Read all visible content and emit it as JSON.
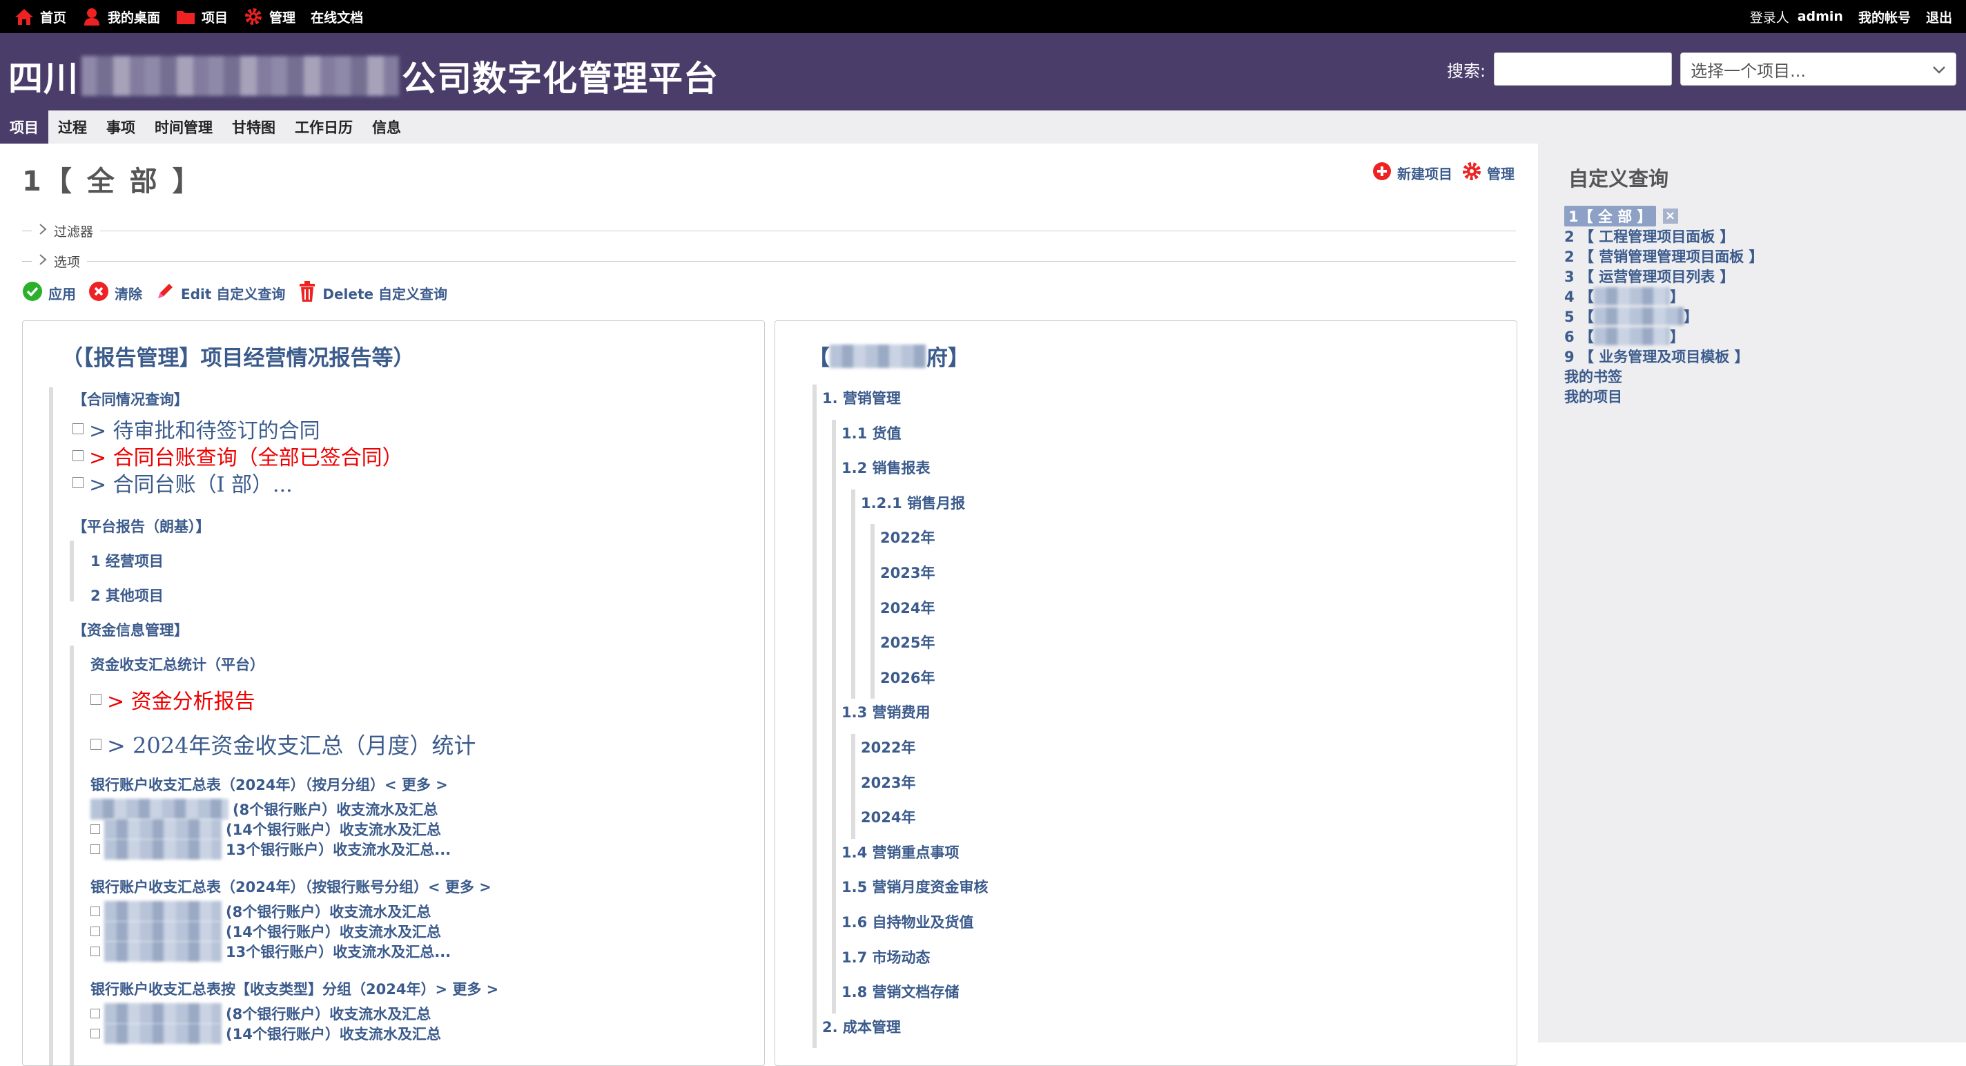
{
  "top_menu": {
    "items": [
      {
        "label": "首页",
        "icon": "home-icon"
      },
      {
        "label": "我的桌面",
        "icon": "user-icon"
      },
      {
        "label": "项目",
        "icon": "folder-icon"
      },
      {
        "label": "管理",
        "icon": "gear-icon"
      },
      {
        "label": "在线文档",
        "icon": ""
      }
    ],
    "login_prefix": "登录人",
    "login_user": "admin",
    "account": "我的帐号",
    "logout": "退出"
  },
  "header": {
    "title_prefix": "四川",
    "title_suffix": "公司数字化管理平台",
    "search_label": "搜索:",
    "search_value": "",
    "project_select": "选择一个项目..."
  },
  "main_menu": {
    "tabs": [
      "项目",
      "过程",
      "事项",
      "时间管理",
      "甘特图",
      "工作日历",
      "信息"
    ]
  },
  "content": {
    "title": "1【 全 部 】",
    "new_project": "新建项目",
    "manage": "管理",
    "filters_label": "过滤器",
    "options_label": "选项",
    "buttons": {
      "apply": "应用",
      "clear": "清除",
      "edit": "Edit 自定义查询",
      "delete": "Delete 自定义查询"
    }
  },
  "left_box": {
    "title": "（【报告管理】项目经营情况报告等）",
    "contract_heading": "【合同情况查询】",
    "contract_items": [
      "> 待审批和待签订的合同",
      "> 合同台账查询（全部已签合同）",
      "> 合同台账（Ⅰ 部）..."
    ],
    "platform_heading": "【平台报告（朗基）】",
    "platform_items": [
      "1 经营项目",
      "2 其他项目"
    ],
    "fund_heading": "【资金信息管理】",
    "fund_sub": "资金收支汇总统计（平台）",
    "fund_items": [
      "> 资金分析报告",
      "> 2024年资金收支汇总（月度）统计"
    ],
    "bank_month": {
      "heading": "银行账户收支汇总表（2024年）（按月分组）< 更多 >",
      "rows": [
        "(8个银行账户）收支流水及汇总",
        "(14个银行账户）收支流水及汇总",
        "13个银行账户）收支流水及汇总..."
      ]
    },
    "bank_account": {
      "heading": "银行账户收支汇总表（2024年）（按银行账号分组）< 更多 >",
      "rows": [
        "(8个银行账户）收支流水及汇总",
        "(14个银行账户）收支流水及汇总",
        "13个银行账户）收支流水及汇总..."
      ]
    },
    "bank_type": {
      "heading": "银行账户收支汇总表按【收支类型】分组（2024年）> 更多 >",
      "rows": [
        "(8个银行账户）收支流水及汇总",
        "(14个银行账户）收支流水及汇总"
      ]
    }
  },
  "right_box": {
    "title_prefix": "【",
    "title_suffix": "府】",
    "items": [
      {
        "label": "1. 营销管理",
        "level": 0
      },
      {
        "label": "1.1 货值",
        "level": 1
      },
      {
        "label": "1.2 销售报表",
        "level": 1
      },
      {
        "label": "1.2.1 销售月报",
        "level": 2
      },
      {
        "label": "2022年",
        "level": 3
      },
      {
        "label": "2023年",
        "level": 3
      },
      {
        "label": "2024年",
        "level": 3
      },
      {
        "label": "2025年",
        "level": 3
      },
      {
        "label": "2026年",
        "level": 3
      },
      {
        "label": "1.3 营销费用",
        "level": 1
      },
      {
        "label": "2022年",
        "level": 2
      },
      {
        "label": "2023年",
        "level": 2
      },
      {
        "label": "2024年",
        "level": 2
      },
      {
        "label": "1.4 营销重点事项",
        "level": 1
      },
      {
        "label": "1.5 营销月度资金审核",
        "level": 1
      },
      {
        "label": "1.6 自持物业及货值",
        "level": 1
      },
      {
        "label": "1.7 市场动态",
        "level": 1
      },
      {
        "label": "1.8 营销文档存储",
        "level": 1
      },
      {
        "label": "2. 成本管理",
        "level": 0
      }
    ]
  },
  "sidebar": {
    "title": "自定义查询",
    "queries": [
      {
        "label": "1【 全 部 】",
        "selected": true
      },
      {
        "label": "2 【 工程管理项目面板 】"
      },
      {
        "label": "2 【 营销管理管理项目面板 】"
      },
      {
        "label": "3 【 运营管理项目列表 】"
      },
      {
        "label": "4 【",
        "tail": "】"
      },
      {
        "label": "5 【",
        "tail": "】"
      },
      {
        "label": "6 【",
        "tail": "】"
      },
      {
        "label": "9 【 业务管理及项目模板 】"
      },
      {
        "label": "我的书签"
      },
      {
        "label": "我的项目"
      }
    ]
  }
}
